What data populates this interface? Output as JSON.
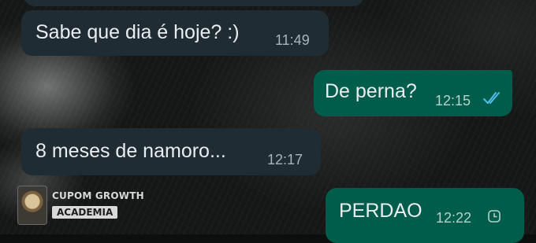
{
  "conversation": {
    "messages": [
      {
        "direction": "incoming",
        "text": "",
        "time": ""
      },
      {
        "direction": "incoming",
        "text": "Sabe que dia é hoje? :)",
        "time": "11:49"
      },
      {
        "direction": "outgoing",
        "text": "De perna?",
        "time": "12:15",
        "status_icon": "double-check-read-icon"
      },
      {
        "direction": "incoming",
        "text": "8 meses de namoro...",
        "time": "12:17"
      },
      {
        "direction": "outgoing",
        "text": "PERDAO",
        "time": "12:22",
        "status_icon": "clock-pending-icon"
      }
    ]
  },
  "watermark": {
    "line1": "CUPOM GROWTH",
    "line2": "ACADEMIA",
    "icon": "avatar-logo"
  },
  "colors": {
    "incoming_bubble": "#1f2c33",
    "outgoing_bubble": "#005c4b",
    "read_ticks": "#53bdeb",
    "text": "#e9edef"
  }
}
